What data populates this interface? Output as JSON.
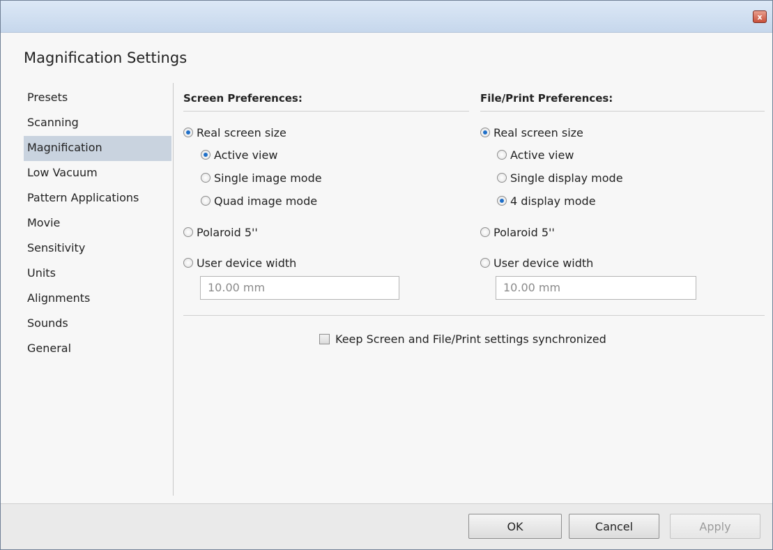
{
  "window": {
    "close_glyph": "x"
  },
  "dialog": {
    "title": "Magnification Settings"
  },
  "sidebar": {
    "items": [
      {
        "label": "Presets",
        "selected": false
      },
      {
        "label": "Scanning",
        "selected": false
      },
      {
        "label": "Magnification",
        "selected": true
      },
      {
        "label": "Low Vacuum",
        "selected": false
      },
      {
        "label": "Pattern Applications",
        "selected": false
      },
      {
        "label": "Movie",
        "selected": false
      },
      {
        "label": "Sensitivity",
        "selected": false
      },
      {
        "label": "Units",
        "selected": false
      },
      {
        "label": "Alignments",
        "selected": false
      },
      {
        "label": "Sounds",
        "selected": false
      },
      {
        "label": "General",
        "selected": false
      }
    ]
  },
  "screen": {
    "heading": "Screen Preferences:",
    "real_screen_size": "Real screen size",
    "active_view": "Active view",
    "single_mode": "Single image mode",
    "quad_mode": "Quad image mode",
    "polaroid": "Polaroid 5''",
    "user_device_width": "User device width",
    "width_value": "10.00 mm"
  },
  "file_print": {
    "heading": "File/Print Preferences:",
    "real_screen_size": "Real screen size",
    "active_view": "Active view",
    "single_mode": "Single display mode",
    "quad_mode": "4 display mode",
    "polaroid": "Polaroid 5''",
    "user_device_width": "User device width",
    "width_value": "10.00 mm"
  },
  "sync": {
    "label": "Keep Screen and File/Print settings synchronized",
    "checked": false
  },
  "buttons": {
    "ok": "OK",
    "cancel": "Cancel",
    "apply": "Apply"
  },
  "colors": {
    "selected_item_bg": "#c9d3df",
    "radio_dot": "#1f6fc8",
    "titlebar": "#c6d7ec"
  }
}
